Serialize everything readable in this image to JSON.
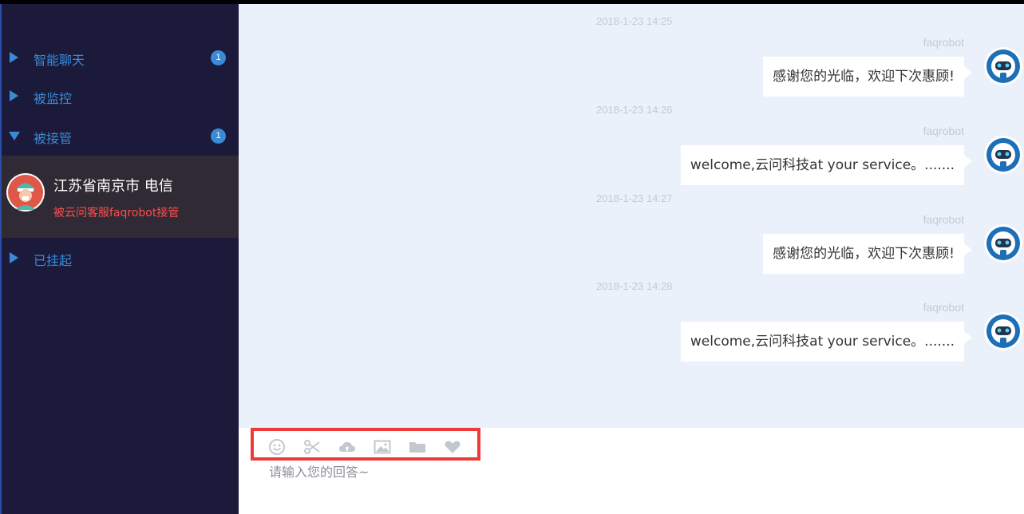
{
  "sidebar": {
    "groups": [
      {
        "label": "智能聊天",
        "badge": "1",
        "state": "collapsed"
      },
      {
        "label": "被监控",
        "badge": "",
        "state": "collapsed"
      },
      {
        "label": "被接管",
        "badge": "1",
        "state": "expanded"
      },
      {
        "label": "已挂起",
        "badge": "",
        "state": "collapsed"
      }
    ],
    "session": {
      "name": "江苏省南京市 电信",
      "status": "被云问客服faqrobot接管",
      "avatar_icon": "nurse-avatar-icon"
    }
  },
  "chat": {
    "messages": [
      {
        "time": "2018-1-23 14:25",
        "sender": "faqrobot",
        "text": "感谢您的光临，欢迎下次惠顾!",
        "avatar_icon": "robot-avatar-icon"
      },
      {
        "time": "2018-1-23 14:26",
        "sender": "faqrobot",
        "text": "welcome,云问科技at your service。.......",
        "avatar_icon": "robot-avatar-icon"
      },
      {
        "time": "2018-1-23 14:27",
        "sender": "faqrobot",
        "text": "感谢您的光临，欢迎下次惠顾!",
        "avatar_icon": "robot-avatar-icon"
      },
      {
        "time": "2018-1-23 14:28",
        "sender": "faqrobot",
        "text": "welcome,云问科技at your service。.......",
        "avatar_icon": "robot-avatar-icon"
      }
    ]
  },
  "input": {
    "placeholder": "请输入您的回答~",
    "tools": [
      "emoji-icon",
      "scissors-icon",
      "cloud-upload-icon",
      "image-icon",
      "folder-icon",
      "heart-icon"
    ]
  },
  "colors": {
    "sidebar_bg": "#1b1a3a",
    "accent": "#3a8ad6",
    "chat_bg": "#eaf1fb",
    "alert": "#ff4d4f",
    "highlight_box": "#f03a3a"
  }
}
